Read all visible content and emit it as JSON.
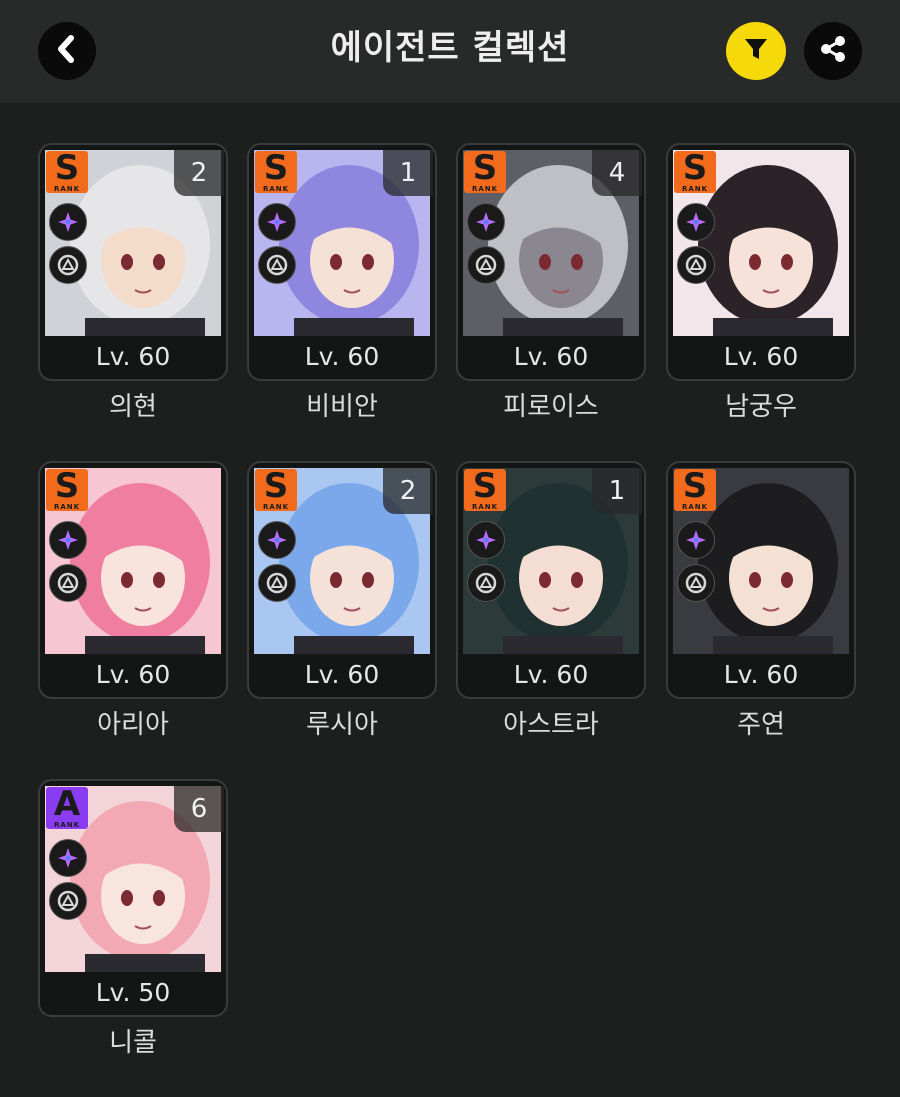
{
  "header": {
    "title": "에이전트 컬렉션",
    "back_icon": "chevron-left-icon",
    "filter_icon": "filter-icon",
    "share_icon": "share-icon",
    "filter_color": "#f5d90a"
  },
  "agents": [
    {
      "name": "의현",
      "level": "Lv. 60",
      "rank": "S",
      "rank_sub": "RANK",
      "count": "2",
      "attribute": "ether-icon",
      "specialty": "attack-icon",
      "hair": "#e6e6e8",
      "bg": "#cfd2d6",
      "skin": "#f4dccb"
    },
    {
      "name": "비비안",
      "level": "Lv. 60",
      "rank": "S",
      "rank_sub": "RANK",
      "count": "1",
      "attribute": "ether-sparkle-icon",
      "specialty": "anomaly-icon",
      "hair": "#8f86e0",
      "bg": "#b9b5ef",
      "skin": "#f5e0d5"
    },
    {
      "name": "피로이스",
      "level": "Lv. 60",
      "rank": "S",
      "rank_sub": "RANK",
      "count": "4",
      "attribute": "ether-sparkle-icon",
      "specialty": "support-icon",
      "hair": "#bfbfc6",
      "bg": "#5e5e66",
      "skin": "#8a8790"
    },
    {
      "name": "남궁우",
      "level": "Lv. 60",
      "rank": "S",
      "rank_sub": "RANK",
      "count": "",
      "attribute": "ether-sparkle-icon",
      "specialty": "defense-icon",
      "hair": "#2b2328",
      "bg": "#f2e6ea",
      "skin": "#f7e2da"
    },
    {
      "name": "아리아",
      "level": "Lv. 60",
      "rank": "S",
      "rank_sub": "RANK",
      "count": "",
      "attribute": "ether-sparkle-icon",
      "specialty": "anomaly-icon",
      "hair": "#f07ea0",
      "bg": "#f6c7d3",
      "skin": "#f8e4dc"
    },
    {
      "name": "루시아",
      "level": "Lv. 60",
      "rank": "S",
      "rank_sub": "RANK",
      "count": "2",
      "attribute": "ether-sparkle-icon",
      "specialty": "rupture-icon",
      "hair": "#7aa8ea",
      "bg": "#a9c7f0",
      "skin": "#f4e2d8"
    },
    {
      "name": "아스트라",
      "level": "Lv. 60",
      "rank": "S",
      "rank_sub": "RANK",
      "count": "1",
      "attribute": "ether-sparkle-icon",
      "specialty": "rupture-icon",
      "hair": "#1f3231",
      "bg": "#2c3b39",
      "skin": "#f4ddd2"
    },
    {
      "name": "주연",
      "level": "Lv. 60",
      "rank": "S",
      "rank_sub": "RANK",
      "count": "",
      "attribute": "ether-sparkle-icon",
      "specialty": "support-icon",
      "hair": "#1d1d1f",
      "bg": "#3a3b40",
      "skin": "#f5e0d4"
    },
    {
      "name": "니콜",
      "level": "Lv. 50",
      "rank": "A",
      "rank_sub": "RANK",
      "count": "6",
      "attribute": "ether-sparkle-icon",
      "specialty": "rupture-icon",
      "hair": "#f2a9b3",
      "bg": "#f3d4d8",
      "skin": "#f8e6de"
    }
  ],
  "colors": {
    "rank_s": "#f26b1d",
    "rank_a": "#8a3cf0",
    "ether": "#b96cff"
  }
}
